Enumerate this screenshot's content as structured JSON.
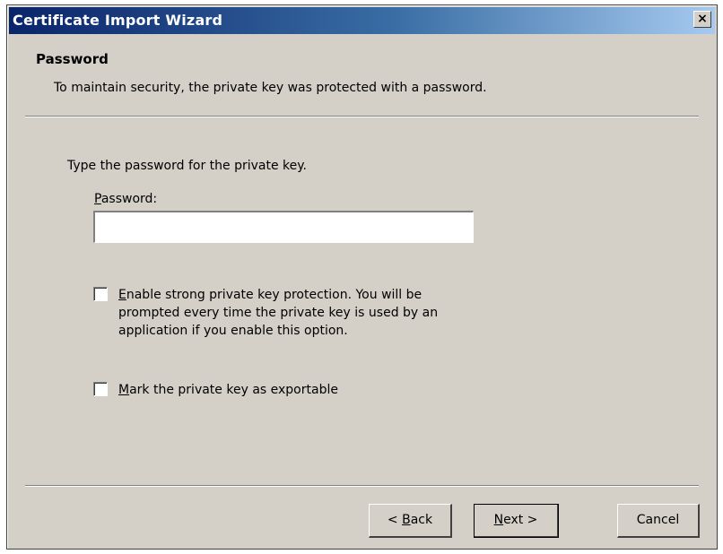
{
  "window": {
    "title": "Certificate Import Wizard",
    "close_glyph": "×"
  },
  "header": {
    "title": "Password",
    "subtitle": "To maintain security, the private key was protected with a password."
  },
  "body": {
    "instruction": "Type the password for the private key.",
    "password_label_mnemonic": "P",
    "password_label_rest": "assword:",
    "password_value": "",
    "strong_protection": {
      "checked": false,
      "mnemonic": "E",
      "line1_rest": "nable strong private key protection. You will be",
      "line2": "prompted every time the private key is used by an",
      "line3": "application if you enable this option."
    },
    "exportable": {
      "checked": false,
      "mnemonic": "M",
      "rest": "ark the private key as exportable"
    }
  },
  "buttons": {
    "back_prefix": "< ",
    "back_mnemonic": "B",
    "back_rest": "ack",
    "next_mnemonic": "N",
    "next_rest": "ext >",
    "cancel": "Cancel"
  },
  "colors": {
    "dialog_face": "#d4d0c8",
    "titlebar_start": "#0a246a",
    "titlebar_end": "#a6caf0"
  }
}
